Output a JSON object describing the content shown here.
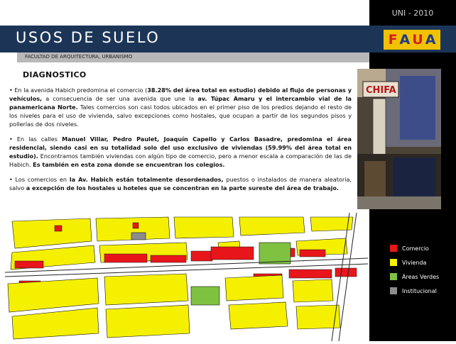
{
  "header": {
    "year_label": "UNI - 2010",
    "title": "USOS  DE  SUELO",
    "subtitle": "FACULTAD DE ARQUITECTURA, URBANISMO",
    "logo_letters": [
      {
        "char": "F",
        "color": "#d41f26"
      },
      {
        "char": "A",
        "color": "#1e3a8a"
      },
      {
        "char": "U",
        "color": "#d41f26"
      },
      {
        "char": "A",
        "color": "#1e3a8a"
      }
    ]
  },
  "section": {
    "heading": "DIAGNOSTICO"
  },
  "paragraphs": {
    "p1": [
      {
        "t": "• En la avenida Habich  predomina el comercio (",
        "b": false
      },
      {
        "t": "38.28% del área total en estudio) debido al flujo de personas y vehículos,",
        "b": true
      },
      {
        "t": " a consecuencia de ser una avenida que une la ",
        "b": false
      },
      {
        "t": "av. Túpac Amaru y el intercambio vial de la panamericana Norte.",
        "b": true
      },
      {
        "t": " Tales comercios son casi todos ubicados en el primer piso de los predios dejando el resto de los niveles para el uso de vivienda, salvo excepciones como hostales, que ocupan a partir de los segundos pisos y pollerías de dos niveles.",
        "b": false
      }
    ],
    "p2": [
      {
        "t": "• En las calles ",
        "b": false
      },
      {
        "t": "Manuel Villar, Pedro Paulet, Joaquín Capello y Carlos Basadre, predomina el área residencial, siendo casi en su totalidad solo del uso exclusivo de viviendas (59.99% del área total en estudio).",
        "b": true
      },
      {
        "t": "  Encontramos también viviendas con algún tipo de comercio, pero a menor escala a comparación de las de Habich. ",
        "b": false
      },
      {
        "t": "Es también en esta zona donde se encuentran los colegios.",
        "b": true
      }
    ],
    "p3": [
      {
        "t": "•  Los comercios en ",
        "b": false
      },
      {
        "t": "la Av. Habich están totalmente desordenados,",
        "b": true
      },
      {
        "t": " puestos o instalados de manera aleatoria, salvo ",
        "b": false
      },
      {
        "t": "a excepción de los hostales u hoteles que se concentran en la parte sureste del área de trabajo.",
        "b": true
      }
    ]
  },
  "legend": {
    "items": [
      {
        "label": "Comercio",
        "color": "#e8161b"
      },
      {
        "label": "Vivienda",
        "color": "#f5f000"
      },
      {
        "label": "Áreas Verdes",
        "color": "#7fc241"
      },
      {
        "label": "Institucional",
        "color": "#8c8c8c"
      }
    ]
  },
  "photo": {
    "sign_text": "CHIFA"
  },
  "colors": {
    "sidebar": "#000000",
    "title_bar": "#1c3557",
    "subtitle_bar": "#b8b8b8",
    "commerce": "#e8161b",
    "housing": "#f5f000",
    "green": "#7fc241",
    "institutional": "#8c8c8c"
  }
}
